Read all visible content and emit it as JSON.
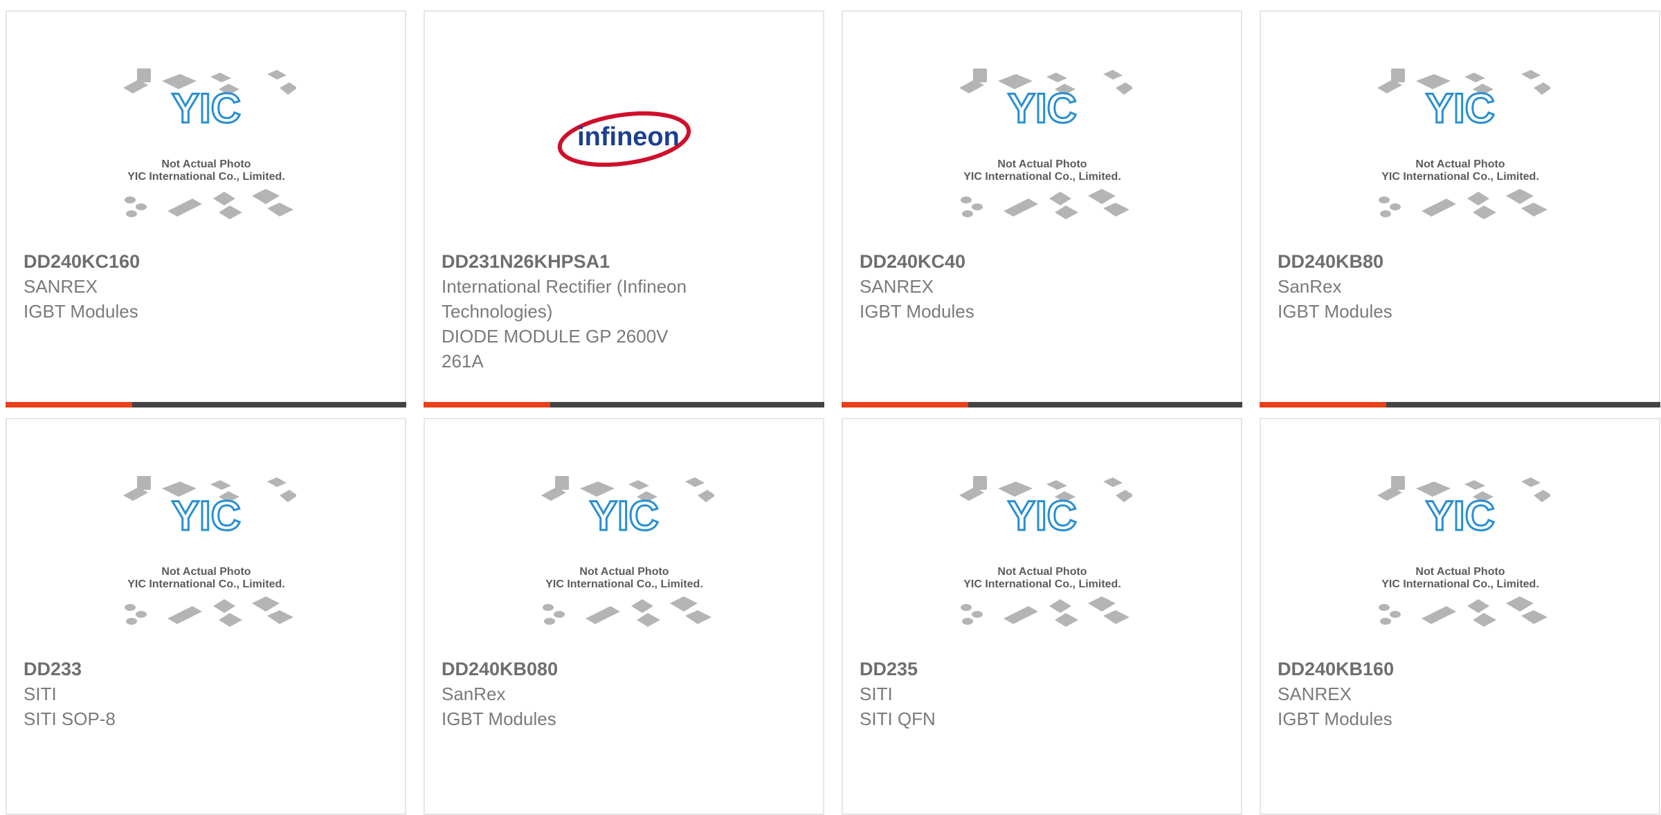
{
  "products": [
    {
      "part_number": "DD240KC160",
      "manufacturer": "SANREX",
      "description": "IGBT Modules",
      "image": "placeholder",
      "placeholder_lines": [
        "Not Actual Photo",
        "YIC International Co., Limited."
      ],
      "logo_text": "YIC"
    },
    {
      "part_number": "DD231N26KHPSA1",
      "manufacturer": "International Rectifier (Infineon Technologies)",
      "description": "DIODE MODULE GP 2600V 261A",
      "image": "infineon-logo",
      "logo_text": "infineon"
    },
    {
      "part_number": "DD240KC40",
      "manufacturer": "SANREX",
      "description": "IGBT Modules",
      "image": "placeholder",
      "placeholder_lines": [
        "Not Actual Photo",
        "YIC International Co., Limited."
      ],
      "logo_text": "YIC"
    },
    {
      "part_number": "DD240KB80",
      "manufacturer": "SanRex",
      "description": "IGBT Modules",
      "image": "placeholder",
      "placeholder_lines": [
        "Not Actual Photo",
        "YIC International Co., Limited."
      ],
      "logo_text": "YIC"
    },
    {
      "part_number": "DD233",
      "manufacturer": "SITI",
      "description": "SITI SOP-8",
      "image": "placeholder",
      "placeholder_lines": [
        "Not Actual Photo",
        "YIC International Co., Limited."
      ],
      "logo_text": "YIC"
    },
    {
      "part_number": "DD240KB080",
      "manufacturer": "SanRex",
      "description": "IGBT Modules",
      "image": "placeholder",
      "placeholder_lines": [
        "Not Actual Photo",
        "YIC International Co., Limited."
      ],
      "logo_text": "YIC"
    },
    {
      "part_number": "DD235",
      "manufacturer": "SITI",
      "description": "SITI QFN",
      "image": "placeholder",
      "placeholder_lines": [
        "Not Actual Photo",
        "YIC International Co., Limited."
      ],
      "logo_text": "YIC"
    },
    {
      "part_number": "DD240KB160",
      "manufacturer": "SANREX",
      "description": "IGBT Modules",
      "image": "placeholder",
      "placeholder_lines": [
        "Not Actual Photo",
        "YIC International Co., Limited."
      ],
      "logo_text": "YIC"
    }
  ],
  "colors": {
    "accent": "#e8411a",
    "bar": "#444444",
    "logo_blue": "#2a8fd0",
    "infineon_blue": "#1d3f8f",
    "infineon_red": "#d0102a",
    "chip_gray": "#b4b4b4",
    "border": "#e6e6e6",
    "text": "#7a7a7a"
  }
}
